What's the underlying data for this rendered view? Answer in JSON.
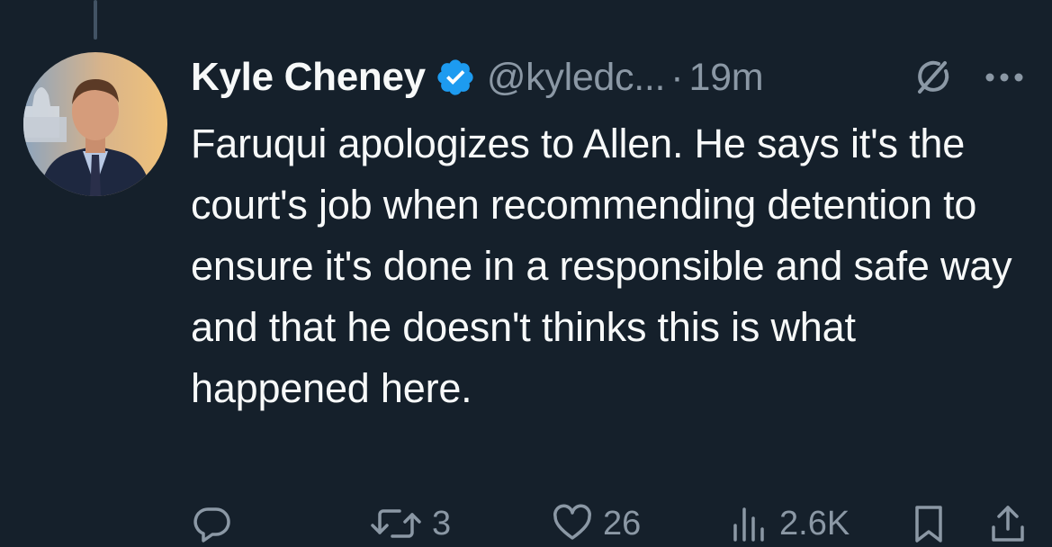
{
  "tweet": {
    "author_name": "Kyle Cheney",
    "handle": "@kyledc...",
    "separator": "·",
    "timestamp": "19m",
    "text": "Faruqui apologizes to Allen. He says it's the court's job when recommending detention to ensure it's done in a responsible and safe way and that he doesn't thinks this is what happened here."
  },
  "actions": {
    "reply_count": "",
    "retweet_count": "3",
    "like_count": "26",
    "view_count": "2.6K"
  },
  "icons": {
    "verified": "verified-badge-icon",
    "grok": "grok-icon",
    "more": "more-icon",
    "reply": "reply-icon",
    "retweet": "retweet-icon",
    "like": "heart-icon",
    "views": "views-icon",
    "bookmark": "bookmark-icon",
    "share": "share-icon"
  },
  "colors": {
    "background": "#15202b",
    "text_primary": "#f7f9f9",
    "text_secondary": "#8b98a5",
    "verified_blue": "#1d9bf0"
  }
}
